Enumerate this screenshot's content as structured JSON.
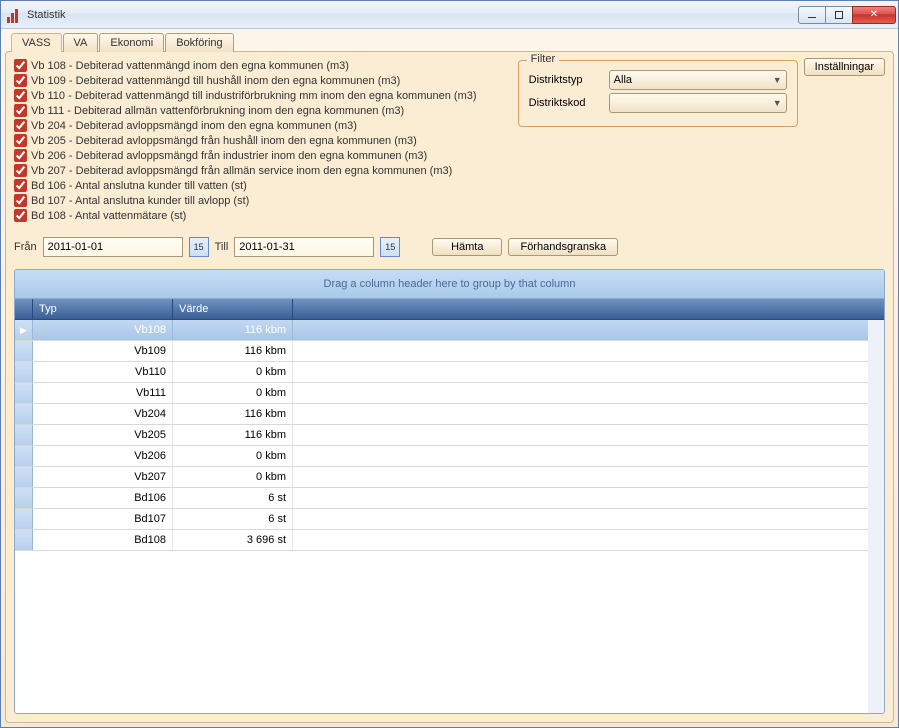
{
  "window": {
    "title": "Statistik"
  },
  "winButtons": {
    "min": "—",
    "max": "",
    "close": "✕"
  },
  "tabs": [
    {
      "label": "VASS",
      "active": true
    },
    {
      "label": "VA",
      "active": false
    },
    {
      "label": "Ekonomi",
      "active": false
    },
    {
      "label": "Bokföring",
      "active": false
    }
  ],
  "checks": [
    {
      "label": "Vb 108 - Debiterad vattenmängd inom den egna kommunen (m3)"
    },
    {
      "label": "Vb 109 - Debiterad vattenmängd till hushåll inom den egna kommunen (m3)"
    },
    {
      "label": "Vb 110 - Debiterad vattenmängd till industriförbrukning mm inom den egna kommunen (m3)"
    },
    {
      "label": "Vb 111 - Debiterad allmän vattenförbrukning inom den egna kommunen (m3)"
    },
    {
      "label": "Vb 204 - Debiterad avloppsmängd inom den egna kommunen (m3)"
    },
    {
      "label": "Vb 205 - Debiterad avloppsmängd från hushåll inom den egna kommunen (m3)"
    },
    {
      "label": "Vb 206 - Debiterad avloppsmängd från industrier inom den egna kommunen (m3)"
    },
    {
      "label": "Vb 207 - Debiterad avloppsmängd från allmän service inom den egna kommunen (m3)"
    },
    {
      "label": "Bd 106 - Antal anslutna kunder till vatten (st)"
    },
    {
      "label": "Bd 107 - Antal anslutna kunder till avlopp (st)"
    },
    {
      "label": "Bd 108 - Antal vattenmätare (st)"
    }
  ],
  "filter": {
    "legend": "Filter",
    "typeLabel": "Distriktstyp",
    "typeValue": "Alla",
    "kodLabel": "Distriktskod",
    "kodValue": ""
  },
  "buttons": {
    "settings": "Inställningar",
    "fetch": "Hämta",
    "preview": "Förhandsgranska",
    "calGlyph": "15"
  },
  "dates": {
    "fromLabel": "Från",
    "fromValue": "2011-01-01",
    "toLabel": "Till",
    "toValue": "2011-01-31"
  },
  "grid": {
    "groupText": "Drag a column header here to group by that column",
    "columns": {
      "typ": "Typ",
      "varde": "Värde"
    },
    "rows": [
      {
        "typ": "Vb108",
        "varde": "116 kbm",
        "selected": true,
        "indicator": "▶"
      },
      {
        "typ": "Vb109",
        "varde": "116 kbm"
      },
      {
        "typ": "Vb110",
        "varde": "0 kbm"
      },
      {
        "typ": "Vb111",
        "varde": "0 kbm"
      },
      {
        "typ": "Vb204",
        "varde": "116 kbm"
      },
      {
        "typ": "Vb205",
        "varde": "116 kbm"
      },
      {
        "typ": "Vb206",
        "varde": "0 kbm"
      },
      {
        "typ": "Vb207",
        "varde": "0 kbm"
      },
      {
        "typ": "Bd106",
        "varde": "6 st"
      },
      {
        "typ": "Bd107",
        "varde": "6 st"
      },
      {
        "typ": "Bd108",
        "varde": "3 696 st"
      }
    ]
  }
}
